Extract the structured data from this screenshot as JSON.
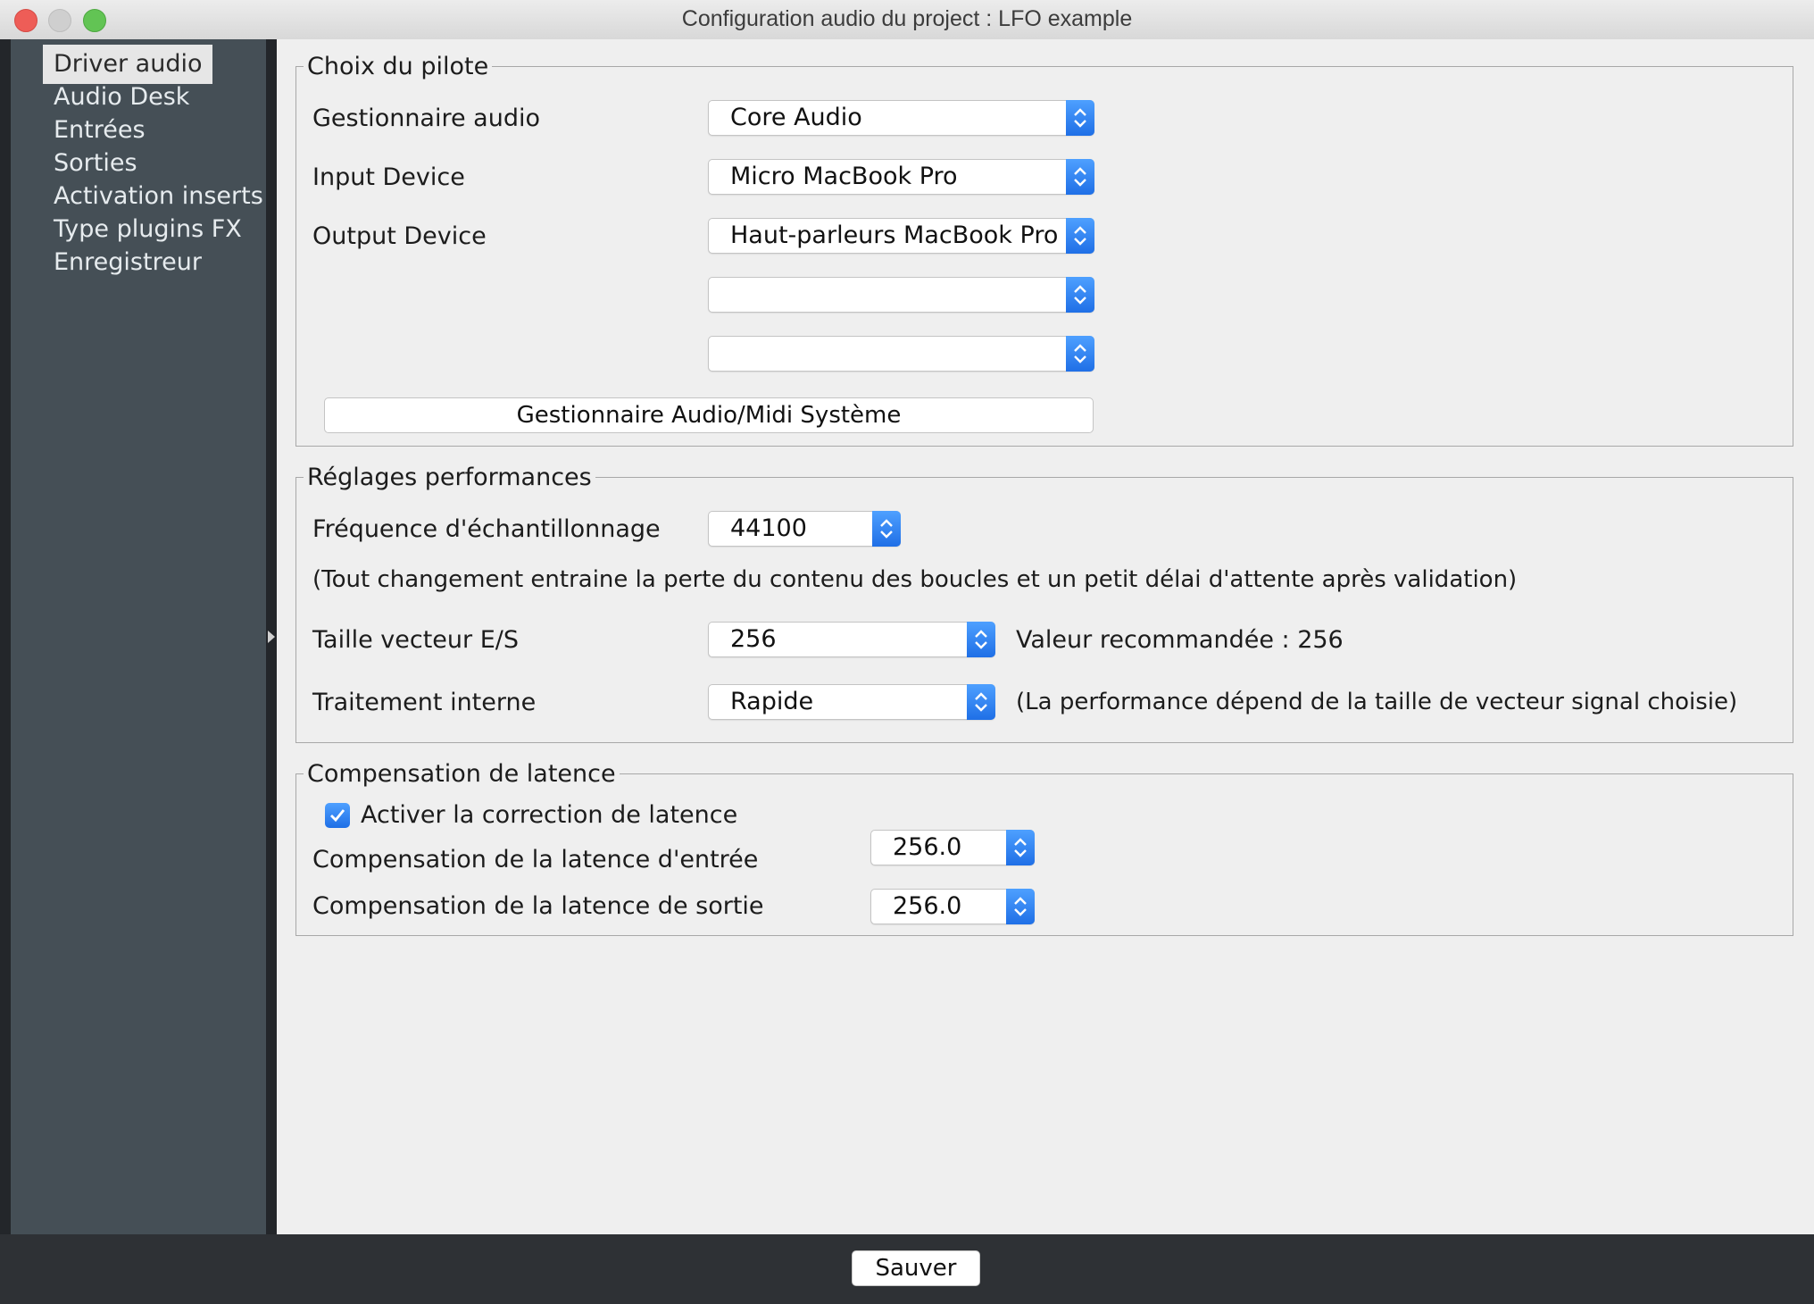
{
  "window": {
    "title": "Configuration audio du project : LFO example"
  },
  "sidebar": {
    "items": [
      {
        "label": "Driver audio",
        "active": true
      },
      {
        "label": "Audio Desk"
      },
      {
        "label": "Entrées"
      },
      {
        "label": "Sorties"
      },
      {
        "label": "Activation inserts"
      },
      {
        "label": "Type plugins FX"
      },
      {
        "label": "Enregistreur"
      }
    ]
  },
  "driver": {
    "legend": "Choix du pilote",
    "audio_manager_label": "Gestionnaire audio",
    "audio_manager_value": "Core Audio",
    "input_label": "Input Device",
    "input_value": "Micro MacBook Pro",
    "output_label": "Output Device",
    "output_value": "Haut-parleurs MacBook Pro",
    "extra1_value": "",
    "extra2_value": "",
    "system_button": "Gestionnaire Audio/Midi Système"
  },
  "performance": {
    "legend": "Réglages performances",
    "samplerate_label": "Fréquence d'échantillonnage",
    "samplerate_value": "44100",
    "note": "(Tout changement entraine la perte du contenu des boucles et un petit délai d'attente après validation)",
    "buffer_label": "Taille vecteur E/S",
    "buffer_value": "256",
    "buffer_hint": "Valeur recommandée : 256",
    "processing_label": "Traitement interne",
    "processing_value": "Rapide",
    "processing_hint": "(La performance dépend de la taille de vecteur signal choisie)"
  },
  "latency": {
    "legend": "Compensation de latence",
    "enable_label": "Activer la correction de latence",
    "enabled": true,
    "input_label": "Compensation de la latence d'entrée",
    "input_value": "256.0",
    "output_label": "Compensation de la latence de sortie",
    "output_value": "256.0"
  },
  "footer": {
    "save_label": "Sauver"
  },
  "colors": {
    "sidebar_bg": "#454f56",
    "accent": "#1f6fe6",
    "content_bg": "#efefef"
  }
}
